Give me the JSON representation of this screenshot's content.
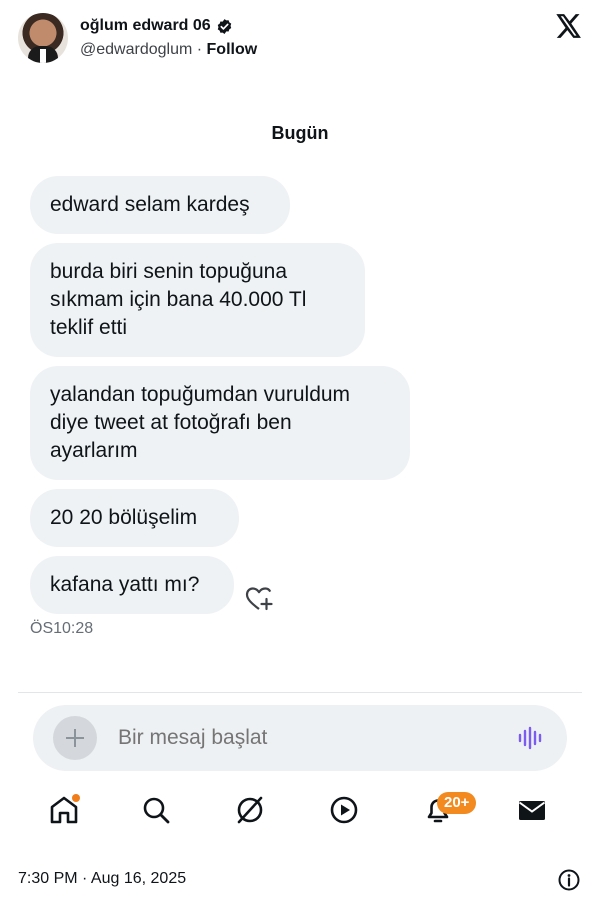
{
  "tweet": {
    "display_name": "oğlum edward 06",
    "handle": "@edwardoglum",
    "separator": " · ",
    "follow_label": "Follow",
    "posted_at": "7:30 PM · Aug 16, 2025"
  },
  "dm": {
    "date_separator": "Bugün",
    "messages": [
      {
        "text": "edward selam kardeş"
      },
      {
        "text": "burda biri senin topuğuna\nsıkmam için bana 40.000 Tl\nteklif etti"
      },
      {
        "text": "yalandan topuğumdan vuruldum\ndiye tweet at fotoğrafı ben\nayarlarım"
      },
      {
        "text": "20 20 bölüşelim"
      },
      {
        "text": "kafana yattı mı?"
      }
    ],
    "last_message_time": "ÖS10:28",
    "composer_placeholder": "Bir mesaj başlat",
    "notifications_badge": "20+"
  },
  "icons": {
    "verified": "verified-badge-icon",
    "brand": "x-logo-icon",
    "add_reaction": "heart-plus-icon",
    "add_attachment": "plus-icon",
    "voice": "voice-wave-icon",
    "nav": [
      "home-icon",
      "search-icon",
      "grok-icon",
      "video-play-icon",
      "bell-icon",
      "mail-icon"
    ],
    "info": "info-icon"
  },
  "colors": {
    "bubble": "#eff2f4",
    "voice_accent": "#7c5cf0",
    "badge": "#f28a1f"
  }
}
